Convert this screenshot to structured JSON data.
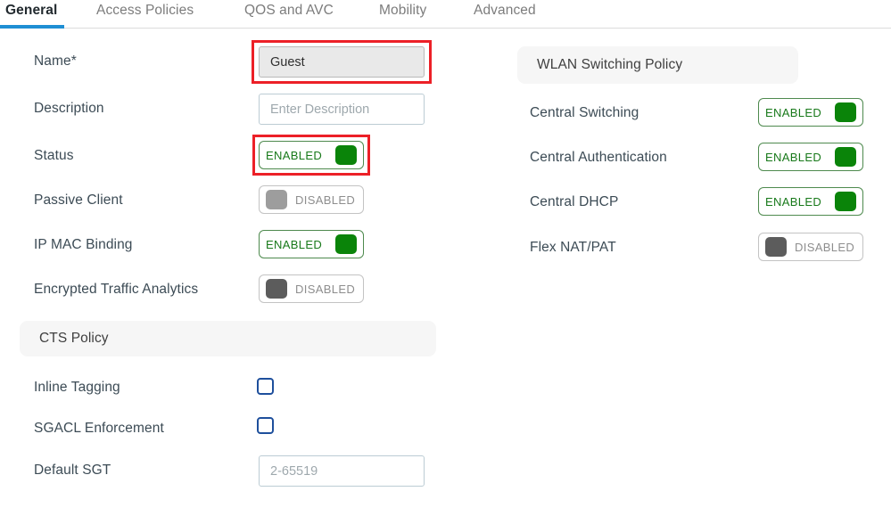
{
  "tabs": [
    {
      "label": "General",
      "active": true
    },
    {
      "label": "Access Policies",
      "active": false
    },
    {
      "label": "QOS and AVC",
      "active": false
    },
    {
      "label": "Mobility",
      "active": false
    },
    {
      "label": "Advanced",
      "active": false
    }
  ],
  "colors": {
    "accent_blue": "#1f8fd4",
    "enabled_green": "#0a8409",
    "enabled_text_green": "#18791a",
    "highlight_red": "#ec2027",
    "checkbox_blue": "#1e4f9c",
    "panel_gray": "#f6f6f6",
    "label_text": "#3c4b55"
  },
  "general": {
    "name": {
      "label": "Name*",
      "value": "Guest",
      "highlighted": true
    },
    "description": {
      "label": "Description",
      "value": "",
      "placeholder": "Enter Description"
    },
    "status": {
      "label": "Status",
      "state": "ENABLED",
      "highlighted": true
    },
    "passive_client": {
      "label": "Passive Client",
      "state": "DISABLED"
    },
    "ip_mac_binding": {
      "label": "IP MAC Binding",
      "state": "ENABLED"
    },
    "encrypted_traffic_analytics": {
      "label": "Encrypted Traffic Analytics",
      "state": "DISABLED"
    }
  },
  "cts_policy": {
    "title": "CTS Policy",
    "inline_tagging": {
      "label": "Inline Tagging",
      "checked": false
    },
    "sgacl_enforcement": {
      "label": "SGACL Enforcement",
      "checked": false
    },
    "default_sgt": {
      "label": "Default SGT",
      "value": "",
      "placeholder": "2-65519"
    }
  },
  "wlan_switching_policy": {
    "title": "WLAN Switching Policy",
    "central_switching": {
      "label": "Central Switching",
      "state": "ENABLED"
    },
    "central_authentication": {
      "label": "Central Authentication",
      "state": "ENABLED"
    },
    "central_dhcp": {
      "label": "Central DHCP",
      "state": "ENABLED"
    },
    "flex_nat_pat": {
      "label": "Flex NAT/PAT",
      "state": "DISABLED"
    }
  }
}
